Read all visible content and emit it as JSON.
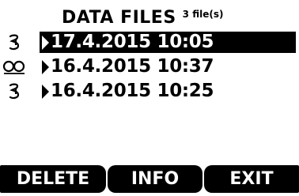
{
  "header": {
    "title": "DATA FILES",
    "count": "3 file(s)"
  },
  "files": [
    {
      "label": "17.4.2015 10:05",
      "icon": "battery-icon",
      "selected": true
    },
    {
      "label": "16.4.2015 10:37",
      "icon": "logging-loop-icon",
      "selected": false
    },
    {
      "label": "16.4.2015 10:25",
      "icon": "battery-icon",
      "selected": false
    }
  ],
  "softkeys": {
    "delete_label": "DELETE",
    "info_label": "INFO",
    "exit_label": "EXIT"
  },
  "colors": {
    "background": "#ffffff",
    "foreground": "#000000",
    "highlight": "#000000",
    "highlight_text": "#ffffff"
  }
}
